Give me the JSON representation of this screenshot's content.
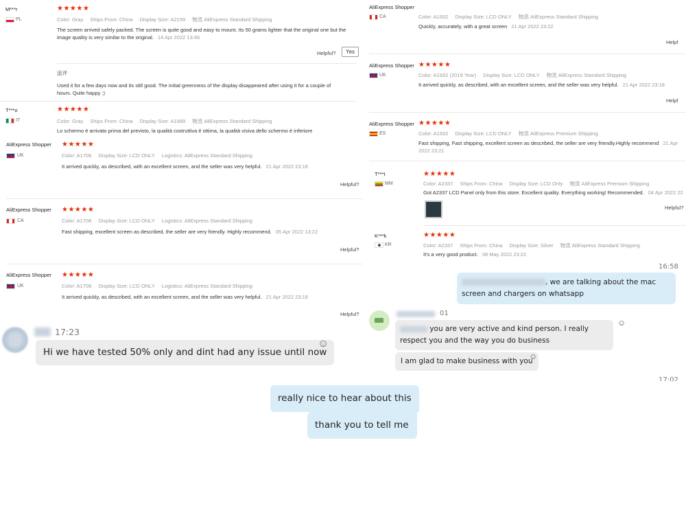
{
  "left_panel": {
    "reviews": [
      {
        "author": "M***r",
        "country": "PL",
        "stars": "★★★★★",
        "meta": [
          "Color: Gray",
          "Ships From: China",
          "Display Size: A2159",
          "物流 AliExpress Standard Shipping"
        ],
        "text": "The screen arrived safely packed. The screen is quite good and easy to mount. Its 50 grams lighter that the original one but the image quality is very similar to the original.",
        "date": "14 Apr 2022 13:46",
        "helpful": "Helpful?",
        "yes": "Yes",
        "followup_label": "追评",
        "followup_text": "Used it for a few days now and its still good. The initial greenness of the display disappeared after using it for a couple of hours. Quite happy :)"
      },
      {
        "author": "T***o",
        "country": "IT",
        "stars": "★★★★★",
        "meta": [
          "Color: Gray",
          "Ships From: China",
          "Display Size: A1989",
          "物流 AliExpress Standard Shipping"
        ],
        "text": "Lo schermo è arrivato prima del previsto, la qualità costruttiva è ottima, la qualità visiva dello schermo è inferiore"
      }
    ]
  },
  "left_panel2": {
    "reviews": [
      {
        "author": "AliExpress Shopper",
        "country": "UK",
        "stars": "★★★★★",
        "meta": [
          "Color: A1706",
          "Display Size: LCD ONLY",
          "Logistics: AliExpress Standard Shipping"
        ],
        "text": "It arrived quickly, as described, with an excellent screen, and the seller was very helpful.",
        "date": "21 Apr 2022 23:18",
        "helpful": "Helpful?"
      },
      {
        "author": "AliExpress Shopper",
        "country": "CA",
        "stars": "★★★★★",
        "meta": [
          "Color: A1708",
          "Display Size: LCD ONLY",
          "Logistics: AliExpress Standard Shipping"
        ],
        "text": "Fast shipping, excellent screen as described, the seller are very friendly. Highly recommend.",
        "date": "05 Apr 2022 13:22",
        "helpful": "Helpful?"
      },
      {
        "author": "AliExpress Shopper",
        "country": "UK",
        "stars": "★★★★★",
        "meta": [
          "Color: A1708",
          "Display Size: LCD ONLY",
          "Logistics: AliExpress Standard Shipping"
        ],
        "text": "It arrived quickly, as described, with an excellent screen, and the seller was very helpful.",
        "date": "21 Apr 2022 23:18",
        "helpful": "Helpful?"
      }
    ]
  },
  "right_panel": {
    "reviews": [
      {
        "author": "AliExpress Shopper",
        "country": "CA",
        "stars": "★★★★★",
        "meta": [
          "Color: A1932",
          "Display Size: LCD ONLY",
          "物流 AliExpress Standard Shipping"
        ],
        "text": "Quickly, accurately, with a great screen",
        "date": "21 Apr 2022 23:22",
        "helpful": "Helpf"
      },
      {
        "author": "AliExpress Shopper",
        "country": "UK",
        "stars": "★★★★★",
        "meta": [
          "Color: A1932 (2019 Year)",
          "Display Size: LCD ONLY",
          "物流 AliExpress Standard Shipping"
        ],
        "text": "It arrived quickly, as described, with an excellent screen, and the seller was very helpful.",
        "date": "21 Apr 2022 23:18",
        "helpful": "Helpf"
      },
      {
        "author": "AliExpress Shopper",
        "country": "ES",
        "stars": "★★★★★",
        "meta": [
          "Color: A1932",
          "Display Size: LCD ONLY",
          "物流 AliExpress Premium Shipping"
        ],
        "text": "Fast shipping, Fast shipping, excellent screen as described, the seller are very friendly.Highly recommend",
        "date": "21 Apr 2022 23:21"
      },
      {
        "author": "T***t",
        "country": "MM",
        "stars": "★★★★★",
        "meta": [
          "Color: A2337",
          "Ships From: China",
          "Display Size: LCD Only",
          "物流 AliExpress Premium Shipping"
        ],
        "text": "Got A2337 LCD Panel only from this store. Excellent quality. Everything working! Recommended.",
        "date": "04 Apr 2022 22",
        "helpful": "Helpful?"
      },
      {
        "author": "K***k",
        "country": "KR",
        "stars": "★★★★★",
        "meta": [
          "Color: A2337",
          "Ships From: China",
          "Display Size: Silver",
          "物流 AliExpress Standard Shipping"
        ],
        "text": "It's a very good product.",
        "date": "08 May 2022 23:22"
      }
    ]
  },
  "chat": {
    "left_time": "17:23",
    "left_msg": "Hi we have tested 50% only and dint had any issue until now",
    "right_time": "16:58",
    "right_msg1": ", we are talking about the mac screen and chargers on whatsapp",
    "peer_time": "01",
    "peer_msg1": "you are very active and kind person.  I really respect you and the way you do business",
    "peer_msg2": "I am glad to make business with you",
    "time_cut": "17:02",
    "out_msg1": "really nice to hear about this",
    "out_msg2": "thank you to tell me"
  },
  "colors": {
    "star": "#e62e04",
    "bubble_blue": "#d9edf8",
    "bubble_gray": "#ececec"
  }
}
